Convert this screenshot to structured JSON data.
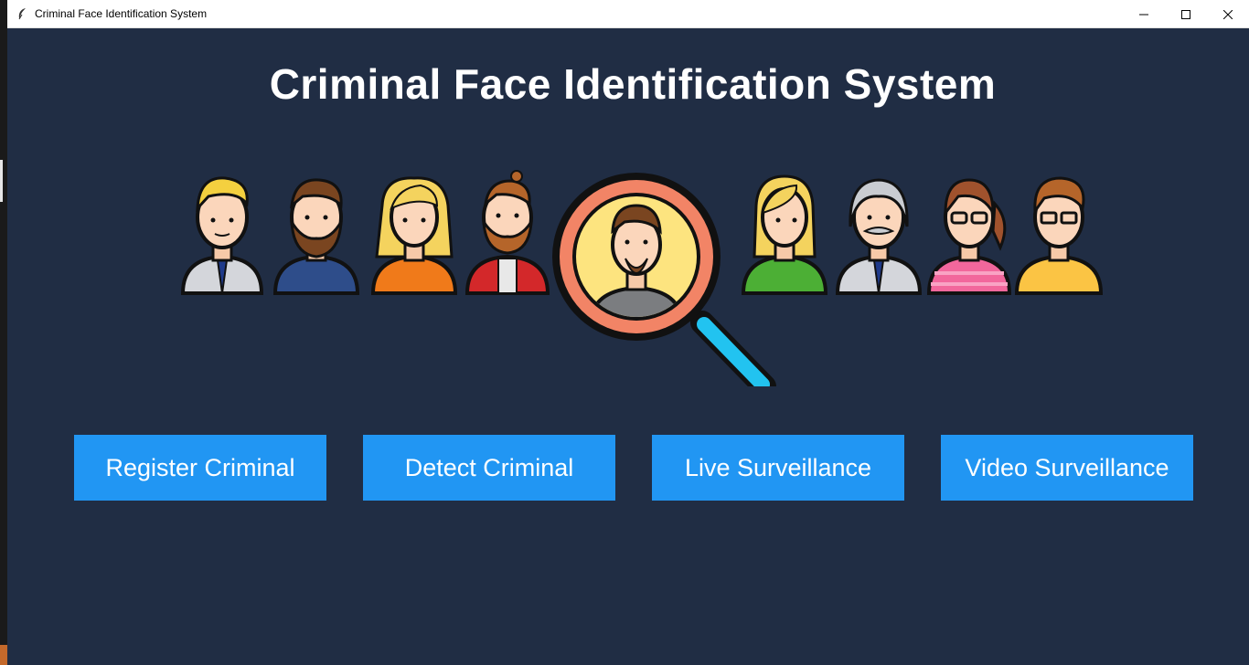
{
  "window": {
    "title": "Criminal Face Identification System"
  },
  "header": {
    "title": "Criminal Face Identification System"
  },
  "buttons": {
    "register": "Register Criminal",
    "detect": "Detect Criminal",
    "live": "Live Surveillance",
    "video": "Video Surveillance"
  },
  "colors": {
    "background": "#202d44",
    "button": "#2196f3",
    "title_text": "#ffffff"
  },
  "icons": {
    "app": "feather-icon",
    "minimize": "minimize-icon",
    "maximize": "maximize-icon",
    "close": "close-icon",
    "hero": "criminal-lineup-magnifier-illustration"
  }
}
